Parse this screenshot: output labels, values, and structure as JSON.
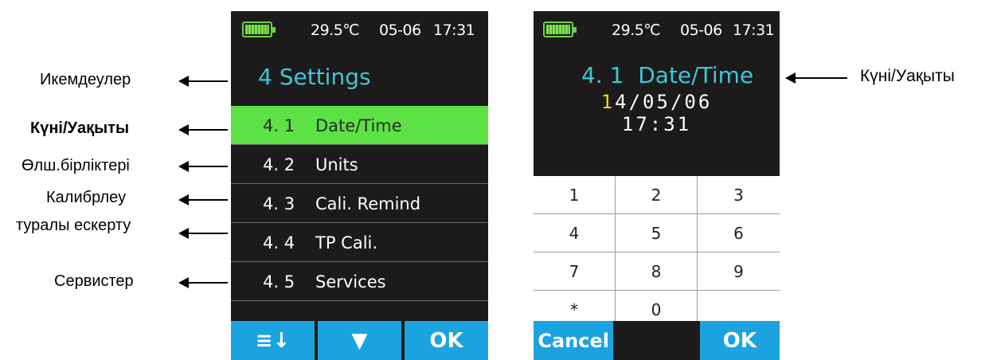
{
  "annotations": {
    "adjustments": "Икемдеулер",
    "date_time": "Күні/Уақыты",
    "units": "Өлш.бірліктері",
    "cali_remind_line1": "Калибрлеу",
    "cali_remind_line2": "туралы ескерту",
    "services": "Сервистер",
    "right_date_time": "Күні/Уақыты"
  },
  "left_screen": {
    "status": {
      "temperature": "29.5℃",
      "date": "05-06",
      "time": "17:31"
    },
    "title": "4 Settings",
    "menu": [
      {
        "num": "4. 1",
        "label": "Date/Time",
        "selected": true
      },
      {
        "num": "4. 2",
        "label": "Units",
        "selected": false
      },
      {
        "num": "4. 3",
        "label": "Cali. Remind",
        "selected": false
      },
      {
        "num": "4. 4",
        "label": "TP Cali.",
        "selected": false
      },
      {
        "num": "4. 5",
        "label": "Services",
        "selected": false
      }
    ],
    "softkeys": {
      "list_icon": "≡↓",
      "down_icon": "▼",
      "ok": "OK"
    }
  },
  "right_screen": {
    "status": {
      "temperature": "29.5℃",
      "date": "05-06",
      "time": "17:31"
    },
    "title": "4. 1  Date/Time",
    "date_cursor_digit": "1",
    "date_rest": "4/05/06",
    "time_value": "17:31",
    "keypad": [
      "1",
      "2",
      "3",
      "4",
      "5",
      "6",
      "7",
      "8",
      "9",
      "*",
      "0",
      ""
    ],
    "softkeys": {
      "cancel": "Cancel",
      "ok": "OK"
    }
  },
  "colors": {
    "screen_bg": "#1c1a1a",
    "title_cyan": "#3cc8d8",
    "selected_green": "#5ce244",
    "softkey_blue": "#1ba3e0",
    "battery_green": "#6fcf4a",
    "cursor_yellow": "#f7d51d"
  }
}
